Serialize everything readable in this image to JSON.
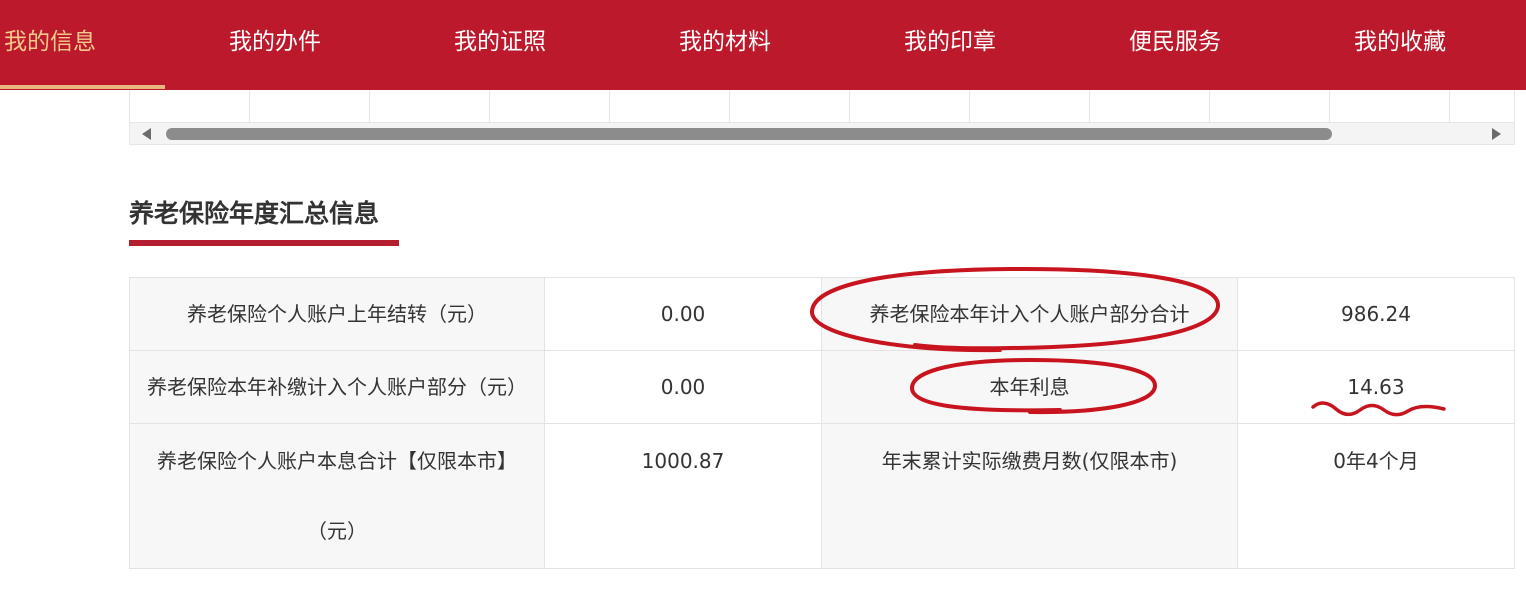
{
  "nav": {
    "items": [
      {
        "label": "我的信息",
        "active": true
      },
      {
        "label": "我的办件",
        "active": false
      },
      {
        "label": "我的证照",
        "active": false
      },
      {
        "label": "我的材料",
        "active": false
      },
      {
        "label": "我的印章",
        "active": false
      },
      {
        "label": "便民服务",
        "active": false
      },
      {
        "label": "我的收藏",
        "active": false
      }
    ],
    "background_color": "#bc1a2c",
    "active_color": "#f3c98c"
  },
  "section": {
    "title": "养老保险年度汇总信息",
    "accent_color": "#b41f2f"
  },
  "summary": {
    "rows": [
      {
        "label1": "养老保险个人账户上年结转（元）",
        "value1": "0.00",
        "label2": "养老保险本年计入个人账户部分合计",
        "value2": "986.24"
      },
      {
        "label1": "养老保险本年补缴计入个人账户部分（元）",
        "value1": "0.00",
        "label2": "本年利息",
        "value2": "14.63"
      },
      {
        "label1_line1": "养老保险个人账户本息合计【仅限本市】",
        "label1_line2": "（元）",
        "value1": "1000.87",
        "label2": "年末累计实际缴费月数(仅限本市)",
        "value2": "0年4个月"
      }
    ]
  },
  "annotation_color": "#c8141e"
}
